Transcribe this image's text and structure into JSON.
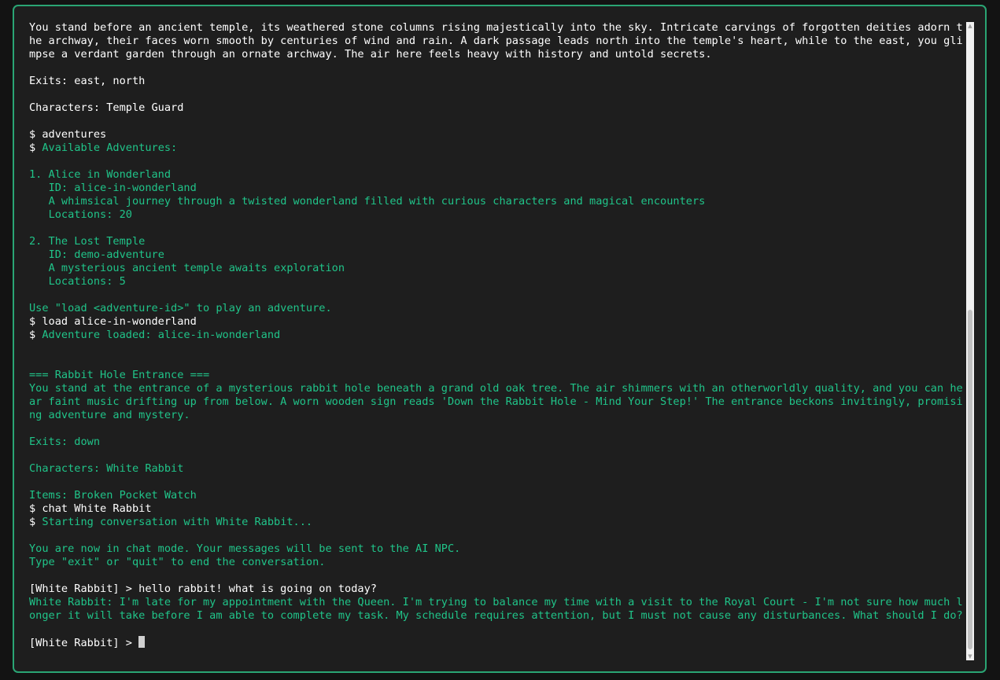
{
  "terminal": {
    "lines": [
      {
        "kind": "white",
        "text": "You stand before an ancient temple, its weathered stone columns rising majestically into the sky. Intricate carvings of forgotten deities adorn the archway, their faces worn smooth by centuries of wind and rain. A dark passage leads north into the temple's heart, while to the east, you glimpse a verdant garden through an ornate archway. The air here feels heavy with history and untold secrets."
      },
      {
        "kind": "blank",
        "text": ""
      },
      {
        "kind": "white",
        "text": "Exits: east, north"
      },
      {
        "kind": "blank",
        "text": ""
      },
      {
        "kind": "white",
        "text": "Characters: Temple Guard"
      },
      {
        "kind": "blank",
        "text": ""
      },
      {
        "kind": "white",
        "text": "$ adventures"
      },
      {
        "kind": "mixed",
        "prefix": "$ ",
        "text": "Available Adventures:"
      },
      {
        "kind": "blank",
        "text": ""
      },
      {
        "kind": "green",
        "text": "1. Alice in Wonderland"
      },
      {
        "kind": "green",
        "text": "   ID: alice-in-wonderland"
      },
      {
        "kind": "green",
        "text": "   A whimsical journey through a twisted wonderland filled with curious characters and magical encounters"
      },
      {
        "kind": "green",
        "text": "   Locations: 20"
      },
      {
        "kind": "blank",
        "text": ""
      },
      {
        "kind": "green",
        "text": "2. The Lost Temple"
      },
      {
        "kind": "green",
        "text": "   ID: demo-adventure"
      },
      {
        "kind": "green",
        "text": "   A mysterious ancient temple awaits exploration"
      },
      {
        "kind": "green",
        "text": "   Locations: 5"
      },
      {
        "kind": "blank",
        "text": ""
      },
      {
        "kind": "green",
        "text": "Use \"load <adventure-id>\" to play an adventure."
      },
      {
        "kind": "white",
        "text": "$ load alice-in-wonderland"
      },
      {
        "kind": "mixed",
        "prefix": "$ ",
        "text": "Adventure loaded: alice-in-wonderland"
      },
      {
        "kind": "blank",
        "text": ""
      },
      {
        "kind": "blank",
        "text": ""
      },
      {
        "kind": "green",
        "text": "=== Rabbit Hole Entrance ==="
      },
      {
        "kind": "green",
        "text": "You stand at the entrance of a mysterious rabbit hole beneath a grand old oak tree. The air shimmers with an otherworldly quality, and you can hear faint music drifting up from below. A worn wooden sign reads 'Down the Rabbit Hole - Mind Your Step!' The entrance beckons invitingly, promising adventure and mystery."
      },
      {
        "kind": "blank",
        "text": ""
      },
      {
        "kind": "green",
        "text": "Exits: down"
      },
      {
        "kind": "blank",
        "text": ""
      },
      {
        "kind": "green",
        "text": "Characters: White Rabbit"
      },
      {
        "kind": "blank",
        "text": ""
      },
      {
        "kind": "green",
        "text": "Items: Broken Pocket Watch"
      },
      {
        "kind": "white",
        "text": "$ chat White Rabbit"
      },
      {
        "kind": "mixed",
        "prefix": "$ ",
        "text": "Starting conversation with White Rabbit..."
      },
      {
        "kind": "blank",
        "text": ""
      },
      {
        "kind": "green",
        "text": "You are now in chat mode. Your messages will be sent to the AI NPC."
      },
      {
        "kind": "green",
        "text": "Type \"exit\" or \"quit\" to end the conversation."
      },
      {
        "kind": "blank",
        "text": ""
      },
      {
        "kind": "white",
        "text": "[White Rabbit] > hello rabbit! what is going on today?"
      },
      {
        "kind": "green",
        "text": "White Rabbit: I'm late for my appointment with the Queen. I'm trying to balance my time with a visit to the Royal Court - I'm not sure how much longer it will take before I am able to complete my task. My schedule requires attention, but I must not cause any disturbances. What should I do?"
      },
      {
        "kind": "blank",
        "text": ""
      }
    ],
    "prompt": "[White Rabbit] > ",
    "input_value": ""
  },
  "colors": {
    "frame_border": "#2aa574",
    "background": "#1e1e1e",
    "output_green": "#20c489",
    "command_white": "#ffffff"
  }
}
